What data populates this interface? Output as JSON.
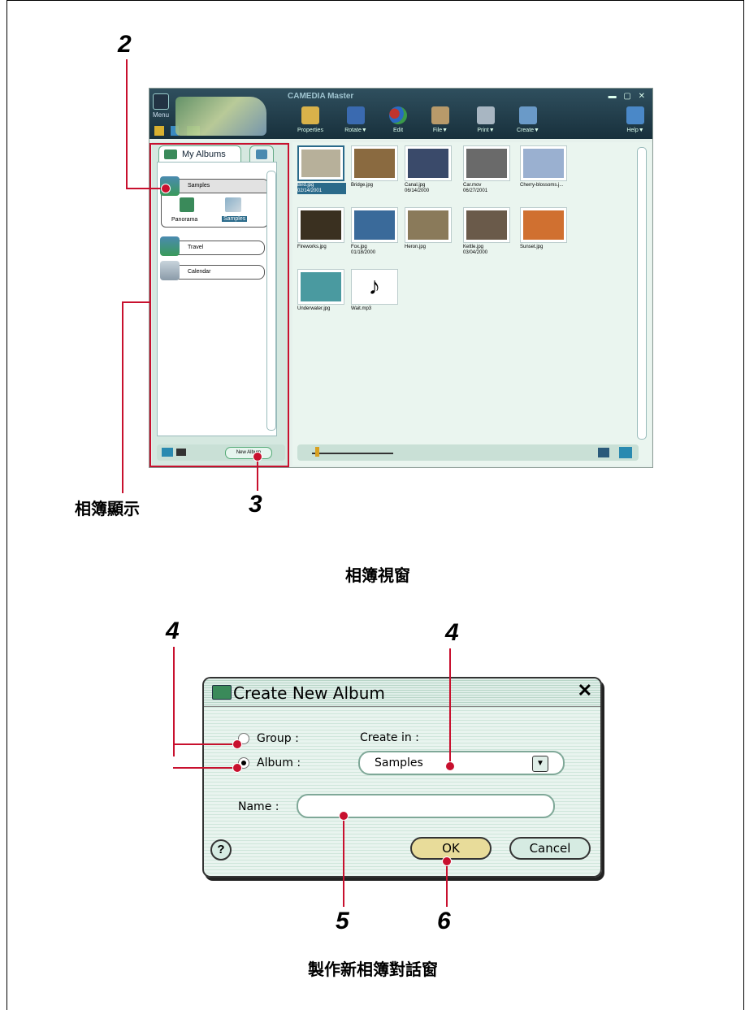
{
  "callouts": {
    "n2": "2",
    "n3": "3",
    "n4a": "4",
    "n4b": "4",
    "n5": "5",
    "n6": "6"
  },
  "captions": {
    "album_display": "相簿顯示",
    "album_window": "相簿視窗",
    "new_album_dialog": "製作新相簿對話窗"
  },
  "app": {
    "title": "CAMEDIA Master",
    "menu_label": "Menu",
    "toolbar": [
      {
        "label": "Properties",
        "color": "#d9b24a"
      },
      {
        "label": "Rotate▼",
        "color": "#3a6ab0"
      },
      {
        "label": "Edit",
        "color": "#c0342e"
      },
      {
        "label": "File▼",
        "color": "#b89a6a"
      },
      {
        "label": "Print▼",
        "color": "#a8b6c2"
      },
      {
        "label": "Create▼",
        "color": "#6a9ac8"
      },
      {
        "label": "Help▼",
        "color": "#4a88c8"
      }
    ],
    "tab_label": "My Albums",
    "albums": [
      "Samples",
      "Travel",
      "Calendar"
    ],
    "sub_items": [
      "Panorama",
      "Samples"
    ],
    "new_album_button": "New Album",
    "thumbnails": [
      {
        "name": "Bird.jpg\n02/14/2001",
        "color": "#b7b09a",
        "selected": true
      },
      {
        "name": "Bridge.jpg",
        "color": "#8a6a40"
      },
      {
        "name": "Canal.jpg\n06/14/2000",
        "color": "#3a4a6a"
      },
      {
        "name": "Car.mov\n06/27/2001",
        "color": "#6a6a6a"
      },
      {
        "name": "Cherry-blossoms.j...",
        "color": "#9ab0d0"
      },
      {
        "name": "Fireworks.jpg",
        "color": "#3a3020"
      },
      {
        "name": "Fox.jpg\n01/18/2000",
        "color": "#3a6a9a"
      },
      {
        "name": "Heron.jpg",
        "color": "#8a7a5a"
      },
      {
        "name": "Kettle.jpg\n03/04/2000",
        "color": "#6a5a4a"
      },
      {
        "name": "Sunset.jpg",
        "color": "#d07030"
      },
      {
        "name": "Underwater.jpg",
        "color": "#4a9aa0"
      },
      {
        "name": "Wait.mp3",
        "color": "#ffffff"
      }
    ]
  },
  "dialog": {
    "title": "Create New Album",
    "close": "✕",
    "group_label": "Group :",
    "album_label": "Album :",
    "create_in_label": "Create in :",
    "create_in_value": "Samples",
    "name_label": "Name :",
    "name_value": "",
    "ok_label": "OK",
    "cancel_label": "Cancel",
    "help": "?"
  },
  "colors": {
    "callout_red": "#c8102e",
    "ok_button": "#e8dc9a"
  }
}
